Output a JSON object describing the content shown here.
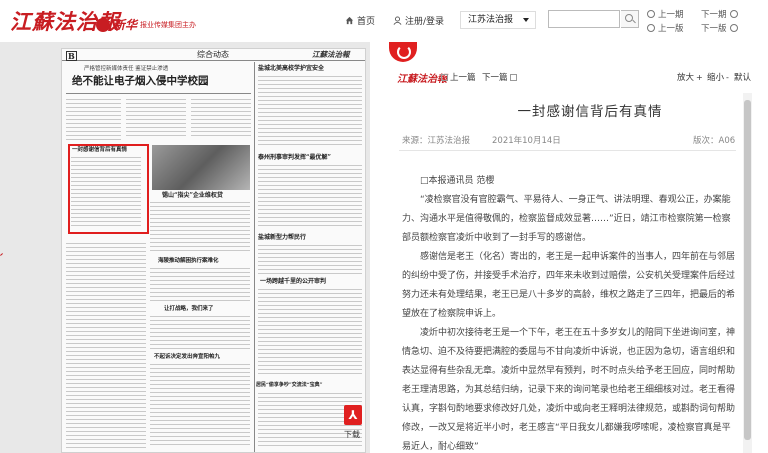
{
  "header": {
    "logo": "江蘇法治報",
    "sublogo_brand": "新华",
    "sublogo_text": "报业传媒集团主办",
    "home_label": "首页",
    "login_label": "注册/登录",
    "edition_select": "江苏法治报",
    "search": {
      "value": "",
      "placeholder": ""
    },
    "prev_issue": "上一期",
    "next_issue": "下一期",
    "prev_page": "上一版",
    "next_page": "下一版"
  },
  "paper": {
    "page_mark": "B",
    "section": "综合动态",
    "masthead": "江蘇法治報",
    "kicker": "严格管控新媒体责任 鉴证禁止渗透",
    "headline_main": "绝不能让电子烟入侵中学校园",
    "highlight_headline": "一封感谢信背后有真情",
    "col_head_1": "盐城北美高校学护宜安全",
    "col_head_2": "泰州刑事审判发挥“最优解”",
    "col_head_3": "锡山“指尖”企业维权贷",
    "col_head_4": "海陵推动解困执行案难化",
    "col_head_5": "盐城新型力帮民行",
    "col_head_6": "一场跨越千里的公开审判",
    "col_head_7": "让打战略，我们来了",
    "col_head_8": "不起诉决定发出奔宣阳帕九",
    "col_head_9": "居民“偷享争吵”交流法“宝典”",
    "download_label": "下载"
  },
  "article": {
    "mini_logo": "江蘇法治報",
    "prev_article": "上一篇",
    "next_article": "下一篇",
    "zoom_in": "放大",
    "zoom_out": "缩小",
    "zoom_default": "默认",
    "title": "一封感谢信背后有真情",
    "source": "来源：江苏法治报",
    "date": "2021年10月14日",
    "edition": "版次：A06",
    "paragraphs": [
      "□本报通讯员 范櫻",
      "“凌检察官没有官腔霸气、平易待人、一身正气、讲法明理、春观公正，办案能力、沟通水平是值得敬佩的，检察监督成效显著……”近日，靖江市检察院第一检察部员额检察官凌炘中收到了一封手写的感谢信。",
      "感谢信是老王（化名）寄出的，老王是一起申诉案件的当事人，四年前在与邻居的纠纷中受了伤，并接受手术治疗，四年来未收到过赔偿，公安机关受理案件后经过努力还未有处理结果，老王已是八十多岁的高龄，维权之路走了三四年，把最后的希望放在了检察院申诉上。",
      "凌炘中初次接待老王是一个下午，老王在五十多岁女儿的陪同下坐进询问室，神情急切、迫不及待要把满腔的委屈与不甘向凌炘中诉说，也正因为急切，语言组织和表达显得有些杂乱无章。凌炘中显然早有预判，时不时点头给予老王回应，同时帮助老王理清思路，为其总结归纳，记录下来的询问笔录也给老王细细核对过。老王看得认真，字斟句酌地要求修改好几处，凌炘中或向老王释明法律规范，或斟酌词句帮助修改，一改又是将近半小时，老王感言“平日我女儿都嫌我啰嗦呢，凌检察官真是平易近人，耐心细致”"
    ]
  }
}
